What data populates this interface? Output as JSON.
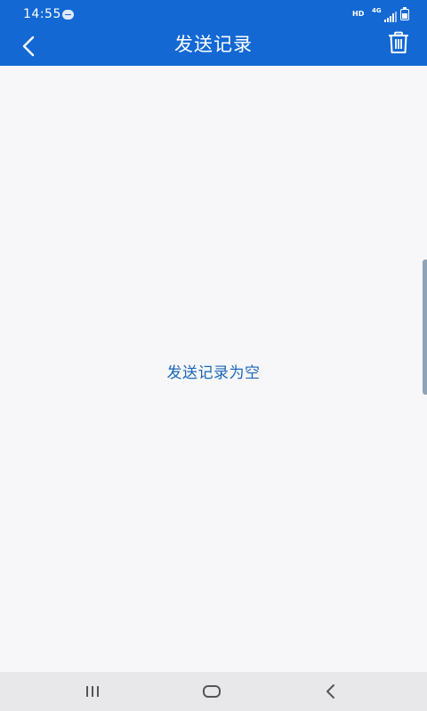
{
  "status_bar": {
    "time": "14:55",
    "network_hd": "HD",
    "network_4g": "4G",
    "icons": [
      "message-icon",
      "signal-icon",
      "battery-icon"
    ]
  },
  "app_bar": {
    "title": "发送记录",
    "back_icon": "chevron-left-icon",
    "delete_icon": "trash-icon"
  },
  "content": {
    "empty_message": "发送记录为空"
  },
  "nav_bar": {
    "icons": [
      "recents-icon",
      "home-icon",
      "back-icon"
    ]
  },
  "colors": {
    "primary": "#1368d4",
    "background": "#f7f7f9",
    "empty_text": "#1b66b8",
    "nav_bar": "#e8e8ea"
  }
}
